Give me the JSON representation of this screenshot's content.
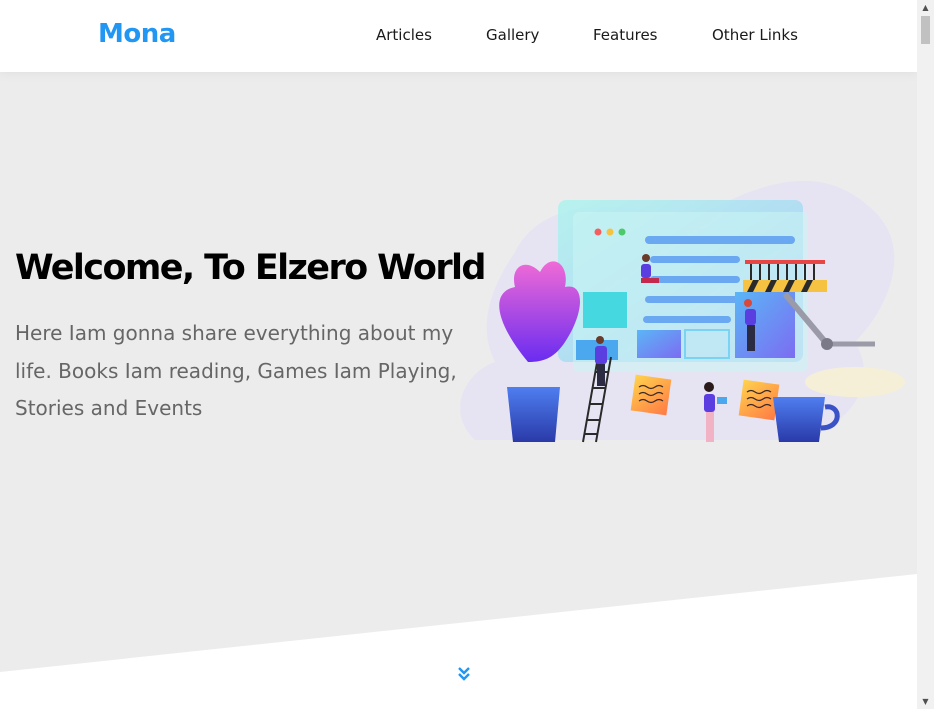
{
  "header": {
    "logo": "Mona",
    "nav": [
      "Articles",
      "Gallery",
      "Features",
      "Other Links"
    ]
  },
  "hero": {
    "title": "Welcome, To Elzero World",
    "text": "Here Iam gonna share everything about my life. Books Iam reading, Games Iam Playing, Stories and Events",
    "illustration": "team-building-webpage-illustration"
  },
  "icons": {
    "scroll_down": "double-chevron-down-icon",
    "scroll_up_arrow": "scroll-up-arrow",
    "scroll_down_arrow": "scroll-down-arrow"
  },
  "colors": {
    "accent": "#2196f3",
    "hero_background": "#ececec",
    "title": "#000000",
    "body_text": "#666666"
  }
}
